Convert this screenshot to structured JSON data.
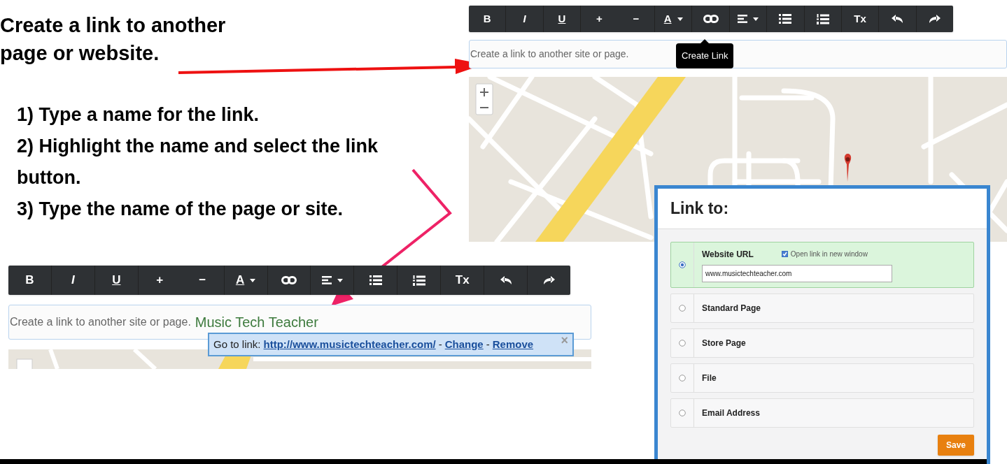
{
  "instructions": {
    "heading_lines": [
      "Create a link to another",
      "page or website."
    ],
    "steps": [
      "1) Type a name for the link.",
      "2) Highlight the name and select the link button.",
      "3) Type the name of the page or site."
    ]
  },
  "editor_before": {
    "toolbar": [
      {
        "kind": "bold",
        "label": "B"
      },
      {
        "kind": "italic",
        "label": "I"
      },
      {
        "kind": "underline",
        "label": "U"
      },
      {
        "kind": "text",
        "label": "+"
      },
      {
        "kind": "text",
        "label": "−"
      },
      {
        "kind": "color",
        "label": "A"
      },
      {
        "kind": "chain"
      },
      {
        "kind": "align"
      },
      {
        "kind": "bullets"
      },
      {
        "kind": "numbers"
      },
      {
        "kind": "clear",
        "label": "Tx"
      },
      {
        "kind": "undo"
      },
      {
        "kind": "redo"
      }
    ],
    "tooltip": "Create Link",
    "text": "Create a link to another site or page."
  },
  "editor_after": {
    "toolbar": [
      {
        "kind": "bold",
        "label": "B"
      },
      {
        "kind": "italic",
        "label": "I"
      },
      {
        "kind": "underline",
        "label": "U"
      },
      {
        "kind": "text",
        "label": "+"
      },
      {
        "kind": "text",
        "label": "−"
      },
      {
        "kind": "color",
        "label": "A"
      },
      {
        "kind": "chain"
      },
      {
        "kind": "align"
      },
      {
        "kind": "bullets"
      },
      {
        "kind": "numbers"
      },
      {
        "kind": "clear",
        "label": "Tx"
      },
      {
        "kind": "undo"
      },
      {
        "kind": "redo"
      }
    ],
    "text": "Create a link to another site or page.",
    "typed": "Music Tech Teacher",
    "link_bubble": {
      "label": "Go to link:",
      "url": "http://www.musictechteacher.com/",
      "separators": [
        "-",
        "-"
      ],
      "change": "Change",
      "remove": "Remove",
      "close": "×"
    }
  },
  "link_dialog": {
    "title": "Link to:",
    "options": [
      {
        "label": "Website URL",
        "selected": true,
        "checkbox": {
          "label": "Open link in new window",
          "checked": true
        },
        "value": "www.musictechteacher.com"
      },
      {
        "label": "Standard Page",
        "selected": false
      },
      {
        "label": "Store Page",
        "selected": false
      },
      {
        "label": "File",
        "selected": false
      },
      {
        "label": "Email Address",
        "selected": false
      }
    ],
    "save": "Save"
  }
}
